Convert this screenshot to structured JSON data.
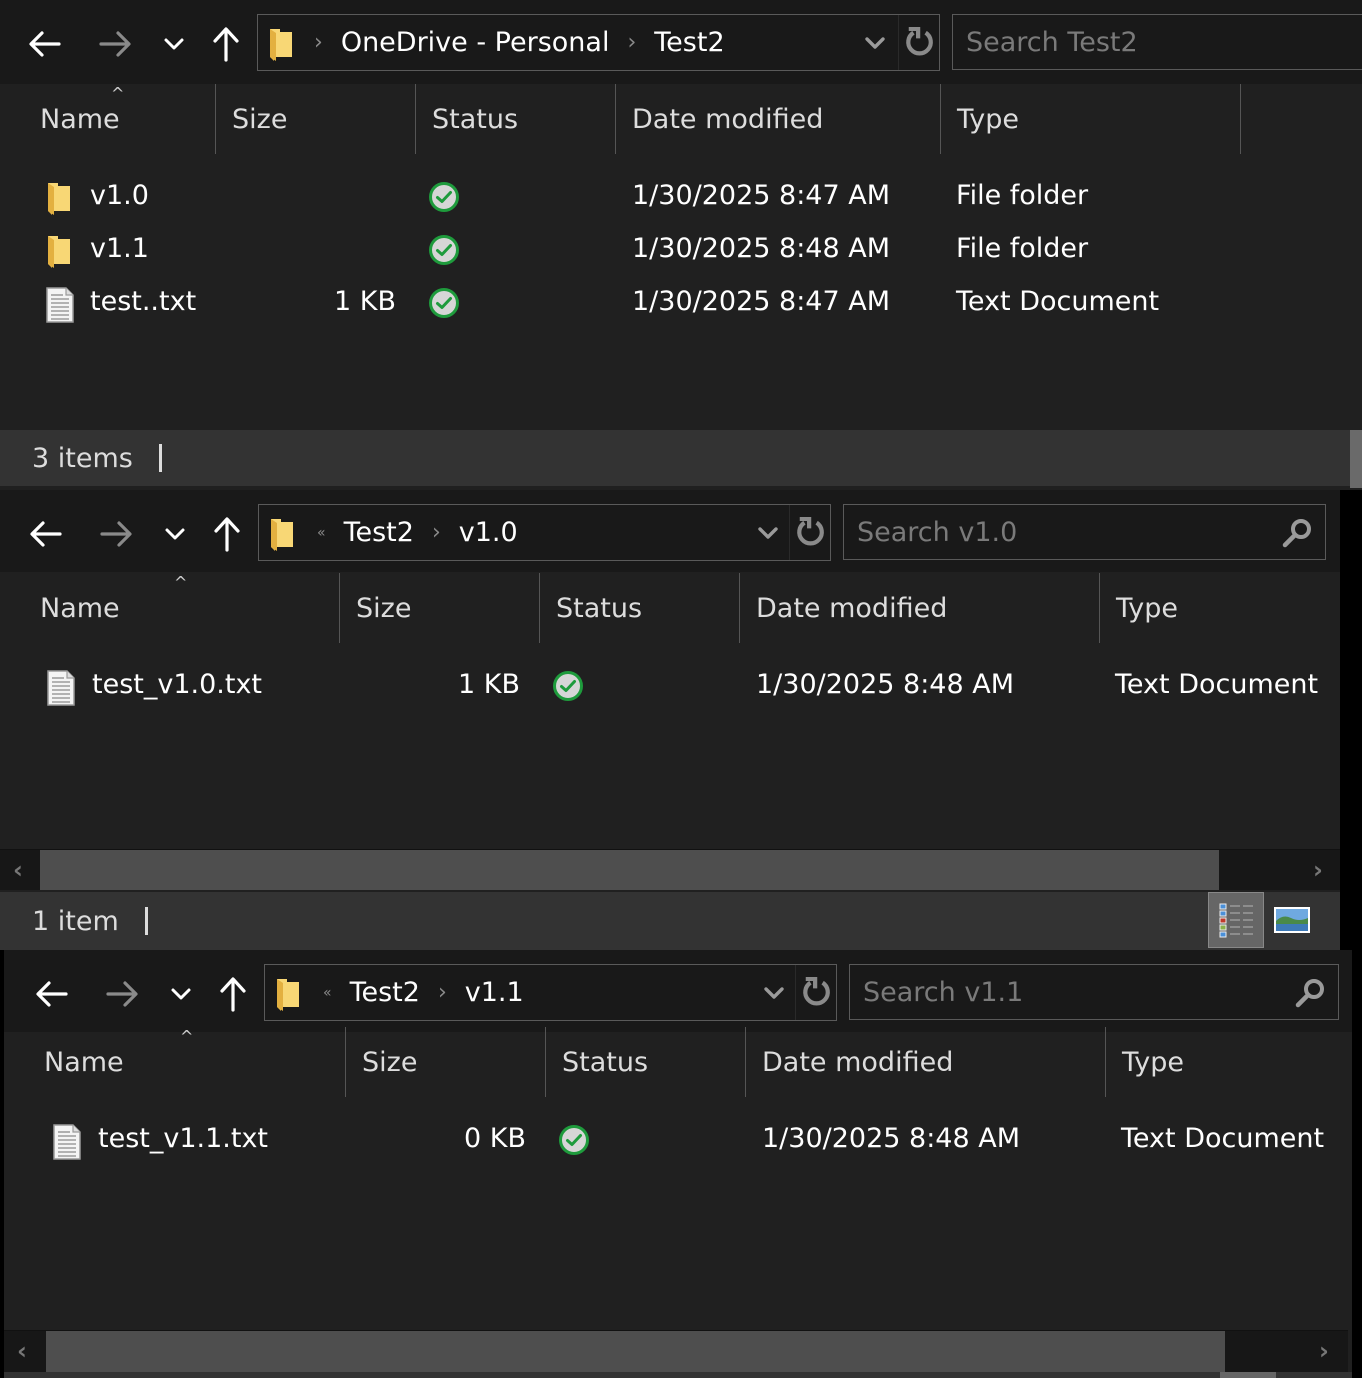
{
  "colors": {
    "background": "#202020",
    "toolbar": "#191919",
    "statusbar": "#333333",
    "folder_yellow": "#f8d775",
    "sync_ok_green": "#1e9b3c",
    "placeholder_gray": "#7a7a7a"
  },
  "windows": [
    {
      "nav": {
        "back": "arrow-left-icon",
        "forward": "arrow-right-icon",
        "recent": "chevron-down-icon",
        "up": "arrow-up-icon"
      },
      "address": {
        "crumbs": [
          "OneDrive - Personal",
          "Test2"
        ],
        "overflow": false
      },
      "search": {
        "placeholder": "Search Test2",
        "value": ""
      },
      "columns": [
        "Name",
        "Size",
        "Status",
        "Date modified",
        "Type"
      ],
      "sorted_by": "Name",
      "files": [
        {
          "name": "v1.0",
          "size": "",
          "status": "synced",
          "date": "1/30/2025 8:47 AM",
          "type": "File folder",
          "icon": "folder-icon"
        },
        {
          "name": "v1.1",
          "size": "",
          "status": "synced",
          "date": "1/30/2025 8:48 AM",
          "type": "File folder",
          "icon": "folder-icon"
        },
        {
          "name": "test..txt",
          "size": "1 KB",
          "status": "synced",
          "date": "1/30/2025 8:47 AM",
          "type": "Text Document",
          "icon": "text-file-icon"
        }
      ],
      "status_text": "3 items"
    },
    {
      "nav": {
        "back": "arrow-left-icon",
        "forward": "arrow-right-icon",
        "recent": "chevron-down-icon",
        "up": "arrow-up-icon"
      },
      "address": {
        "crumbs": [
          "Test2",
          "v1.0"
        ],
        "overflow": true
      },
      "search": {
        "placeholder": "Search v1.0",
        "value": ""
      },
      "columns": [
        "Name",
        "Size",
        "Status",
        "Date modified",
        "Type"
      ],
      "sorted_by": "Name",
      "files": [
        {
          "name": "test_v1.0.txt",
          "size": "1 KB",
          "status": "synced",
          "date": "1/30/2025 8:48 AM",
          "type": "Text Document",
          "icon": "text-file-icon"
        }
      ],
      "status_text": "1 item",
      "view_buttons": [
        "details-view",
        "large-icons-view"
      ],
      "active_view": "details-view"
    },
    {
      "nav": {
        "back": "arrow-left-icon",
        "forward": "arrow-right-icon",
        "recent": "chevron-down-icon",
        "up": "arrow-up-icon"
      },
      "address": {
        "crumbs": [
          "Test2",
          "v1.1"
        ],
        "overflow": true
      },
      "search": {
        "placeholder": "Search v1.1",
        "value": ""
      },
      "columns": [
        "Name",
        "Size",
        "Status",
        "Date modified",
        "Type"
      ],
      "sorted_by": "Name",
      "files": [
        {
          "name": "test_v1.1.txt",
          "size": "0 KB",
          "status": "synced",
          "date": "1/30/2025 8:48 AM",
          "type": "Text Document",
          "icon": "text-file-icon"
        }
      ]
    }
  ]
}
